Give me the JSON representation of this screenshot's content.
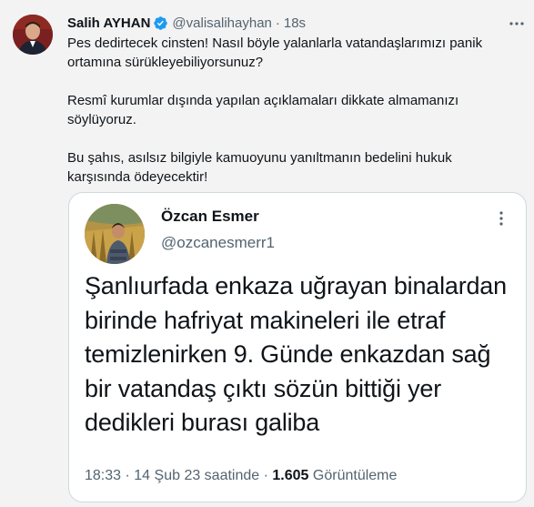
{
  "author": {
    "name": "Salih AYHAN",
    "handle": "@valisalihayhan",
    "separator": "·",
    "time": "18s",
    "verified_color": "#1d9bf0"
  },
  "tweet": {
    "paragraphs": [
      "Pes dedirtecek cinsten! Nasıl böyle yalanlarla vatandaşlarımızı panik ortamına sürükleyebiliyorsunuz?",
      "Resmî kurumlar dışında yapılan açıklamaları dikkate almamanızı söylüyoruz.",
      "Bu şahıs, asılsız bilgiyle kamuoyunu yanıltmanın bedelini hukuk karşısında ödeyecektir!"
    ]
  },
  "quoted": {
    "name": "Özcan Esmer",
    "handle": "@ozcanesmerr1",
    "text": "Şanlıurfada enkaza uğrayan binalardan birinde hafriyat makineleri ile etraf temizlenirken 9. Günde enkazdan sağ bir vatandaş çıktı sözün bittiği yer dedikleri burası galiba",
    "time": "18:33",
    "separator": "·",
    "date": "14 Şub 23 saatinde",
    "views_count": "1.605",
    "views_label": "Görüntüleme"
  },
  "icons": {
    "verified": "verified-badge-icon",
    "more": "more-horizontal-icon",
    "quote_more": "more-vertical-icon"
  }
}
